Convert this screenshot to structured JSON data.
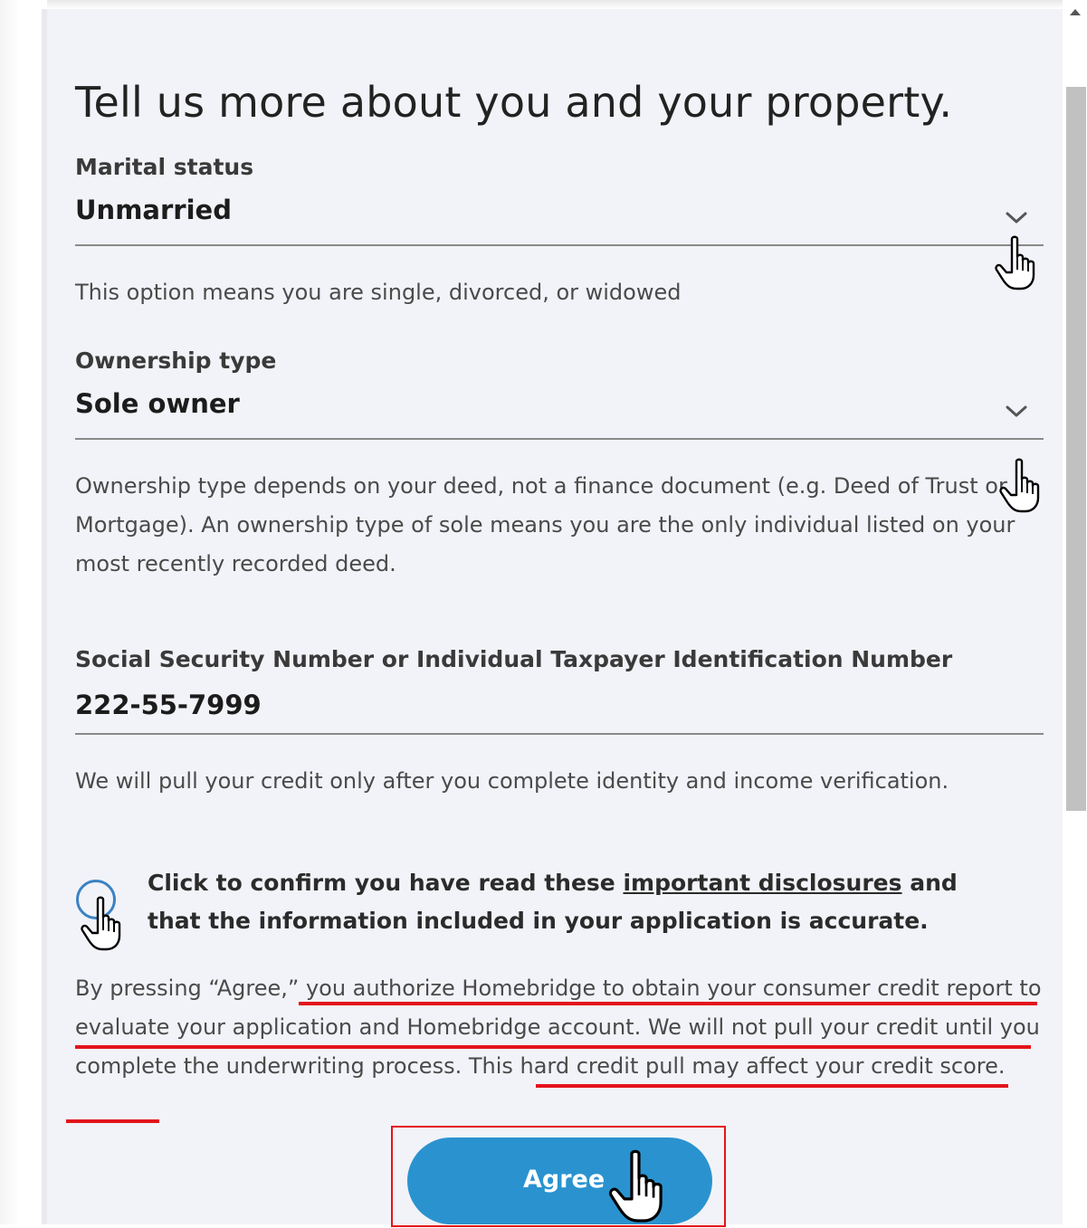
{
  "form": {
    "title": "Tell us more about you and your property.",
    "marital": {
      "label": "Marital status",
      "value": "Unmarried",
      "helper": "This option means you are single, divorced, or widowed"
    },
    "ownership": {
      "label": "Ownership type",
      "value": "Sole owner",
      "helper": "Ownership type depends on your deed, not a finance document (e.g. Deed of Trust or Mortgage). An ownership type of sole means you are the only individual listed on your most recently recorded deed."
    },
    "ssn": {
      "label": "Social Security Number or Individual Taxpayer Identification Number",
      "value": "222-55-7999",
      "helper": "We will pull your credit only after you complete identity and income verification."
    },
    "confirm": {
      "before": "Click to confirm you have read these ",
      "link": "important disclosures",
      "after": " and that the information included in your application is accurate."
    },
    "legal": "By pressing “Agree,” you authorize Homebridge to obtain your consumer credit report to evaluate your application and Homebridge account. We will not pull your credit until you complete the underwriting process. This hard credit pull may affect your credit score.",
    "agree_button": "Agree"
  },
  "colors": {
    "panel_bg": "#f2f3f8",
    "button": "#2a93cf",
    "annotation_red": "#e3141b",
    "radio_border": "#3b82c4"
  },
  "icons": [
    "chevron-down-icon",
    "hand-pointer-cursor-icon",
    "scroll-up-arrow-icon"
  ]
}
